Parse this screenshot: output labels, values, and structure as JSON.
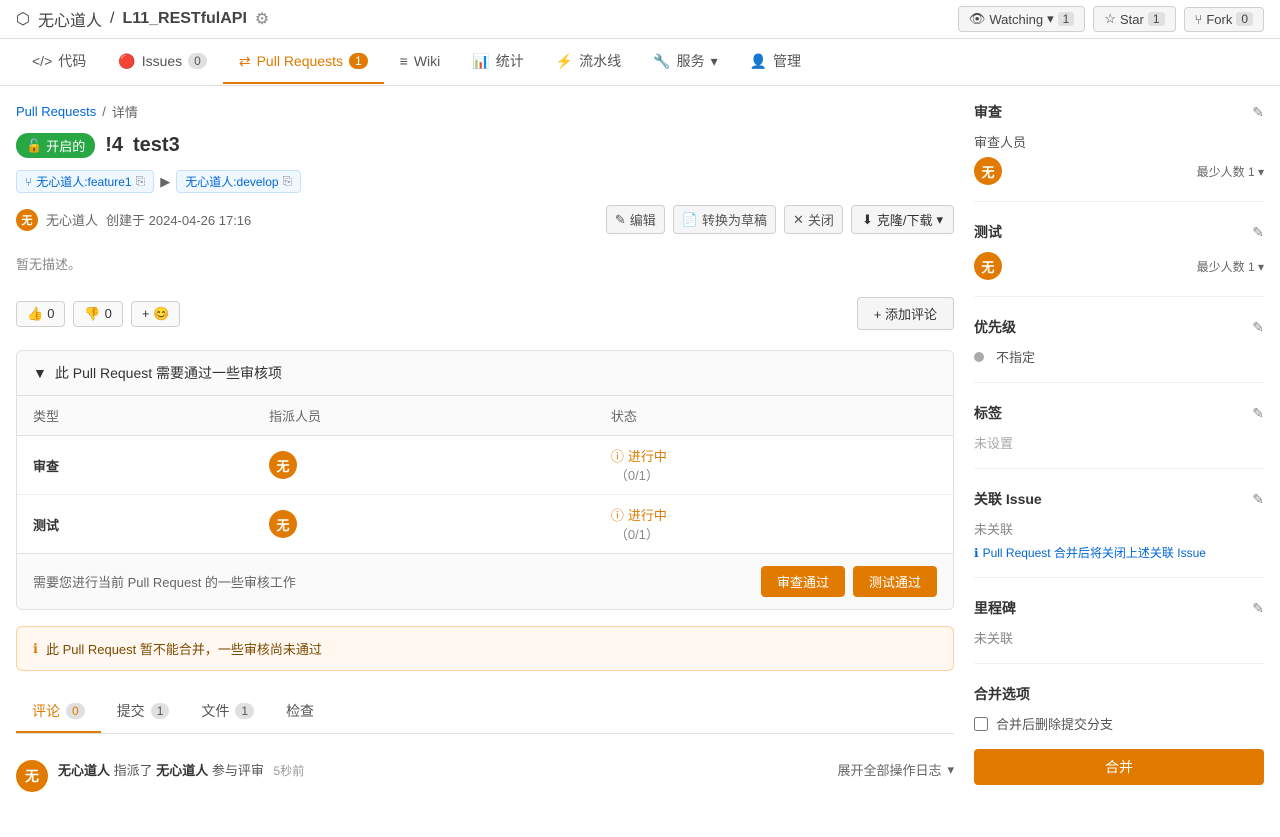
{
  "repo": {
    "owner": "无心道人",
    "name": "L11_RESTfulAPI",
    "settings_icon": "⚙"
  },
  "top_actions": {
    "watch_label": "Watching",
    "watch_count": "1",
    "star_label": "Star",
    "star_count": "1",
    "fork_label": "Fork",
    "fork_count": "0"
  },
  "nav": {
    "tabs": [
      {
        "id": "code",
        "icon": "</>",
        "label": "代码",
        "badge": null,
        "active": false
      },
      {
        "id": "issues",
        "icon": "!",
        "label": "Issues",
        "badge": "0",
        "active": false
      },
      {
        "id": "pulls",
        "icon": "⇄",
        "label": "Pull Requests",
        "badge": "1",
        "active": true
      },
      {
        "id": "wiki",
        "icon": "≡",
        "label": "Wiki",
        "badge": null,
        "active": false
      },
      {
        "id": "stats",
        "icon": "📊",
        "label": "统计",
        "badge": null,
        "active": false
      },
      {
        "id": "pipeline",
        "icon": "⚡",
        "label": "流水线",
        "badge": null,
        "active": false
      },
      {
        "id": "services",
        "icon": "🔧",
        "label": "服务",
        "badge": null,
        "active": false,
        "has_dropdown": true
      },
      {
        "id": "manage",
        "icon": "👤",
        "label": "管理",
        "badge": null,
        "active": false
      }
    ]
  },
  "breadcrumb": {
    "parent": "Pull Requests",
    "current": "详情"
  },
  "pr": {
    "number": "!4",
    "title": "test3",
    "status": "开启的",
    "source_branch": "无心道人:feature1",
    "target_branch": "无心道人:develop",
    "author": "无心道人",
    "author_initial": "无",
    "created_at": "创建于 2024-04-26 17:16",
    "description": "暂无描述。",
    "actions": {
      "edit": "编辑",
      "draft": "转换为草稿",
      "close": "关闭",
      "clone": "克隆/下载"
    }
  },
  "reactions": {
    "thumbs_up": "0",
    "thumbs_down": "0",
    "add_emoji": "+ 😊",
    "add_comment": "+ 添加评论"
  },
  "review_checklist": {
    "header": "此 Pull Request 需要通过一些审核项",
    "columns": {
      "type": "类型",
      "assignee": "指派人员",
      "status": "状态"
    },
    "rows": [
      {
        "type": "审查",
        "assignee_initial": "无",
        "status_label": "进行中",
        "progress": "(0/1)"
      },
      {
        "type": "测试",
        "assignee_initial": "无",
        "status_label": "进行中",
        "progress": "(0/1)"
      }
    ],
    "footer_text": "需要您进行当前 Pull Request 的一些审核工作",
    "approve_btn": "审查通过",
    "test_btn": "测试通过"
  },
  "warning": {
    "text": "此 Pull Request 暂不能合并，一些审核尚未通过"
  },
  "pr_tabs": [
    {
      "id": "comments",
      "label": "评论",
      "badge": "0",
      "active": true
    },
    {
      "id": "commits",
      "label": "提交",
      "badge": "1",
      "active": false
    },
    {
      "id": "files",
      "label": "文件",
      "badge": "1",
      "active": false
    },
    {
      "id": "checks",
      "label": "检查",
      "badge": null,
      "active": false
    }
  ],
  "activity": {
    "items": [
      {
        "avatar_initial": "无",
        "text_before": "无心道人",
        "action": "指派了",
        "target": "无心道人",
        "action2": "参与评审",
        "time": "5秒前"
      }
    ],
    "expand_log": "展开全部操作日志"
  },
  "sidebar": {
    "review_section": {
      "title": "审查",
      "reviewer_label": "审查人员",
      "reviewer_initial": "无",
      "min_count": "最少人数 1"
    },
    "test_section": {
      "title": "测试",
      "reviewer_initial": "无",
      "min_count": "最少人数 1"
    },
    "priority_section": {
      "title": "优先级",
      "value": "不指定"
    },
    "labels_section": {
      "title": "标签",
      "value": "未设置"
    },
    "related_issue_section": {
      "title": "关联 Issue",
      "value": "未关联",
      "note": "Pull Request 合并后将关闭上述关联 Issue"
    },
    "milestone_section": {
      "title": "里程碑",
      "value": "未关联"
    },
    "merge_options": {
      "title": "合并选项",
      "delete_branch_label": "合并后删除提交分支",
      "merge_btn_label": "合并"
    }
  }
}
